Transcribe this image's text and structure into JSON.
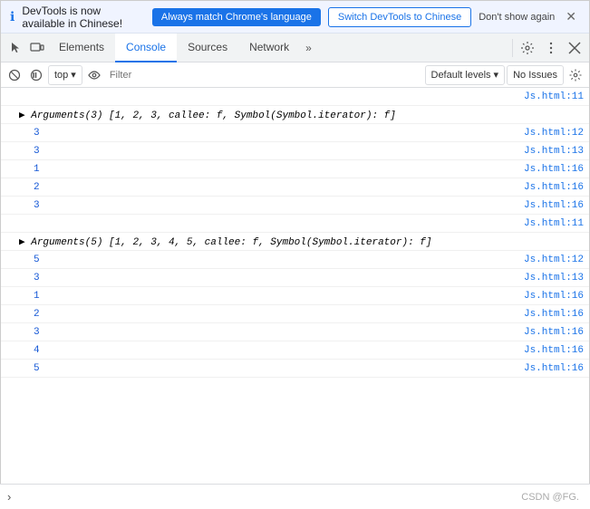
{
  "notification": {
    "text": "DevTools is now available in Chinese!",
    "btn_match_label": "Always match Chrome's language",
    "btn_switch_label": "Switch DevTools to Chinese",
    "dont_show_label": "Don't show again",
    "info_icon": "ℹ",
    "close_icon": "✕"
  },
  "tabs": {
    "icon_cursor": "⬚",
    "icon_device": "⬜",
    "items": [
      {
        "label": "Elements",
        "active": false
      },
      {
        "label": "Console",
        "active": true
      },
      {
        "label": "Sources",
        "active": false
      },
      {
        "label": "Network",
        "active": false
      }
    ],
    "more_icon": "»",
    "settings_icon": "⚙",
    "menu_icon": "⋮",
    "close_icon": "✕"
  },
  "console_toolbar": {
    "clear_icon": "🚫",
    "context_label": "top",
    "arrow_icon": "▾",
    "eye_icon": "👁",
    "filter_placeholder": "Filter",
    "level_label": "Default levels",
    "level_arrow": "▾",
    "no_issues_label": "No Issues",
    "settings_icon": "⚙"
  },
  "console_rows": [
    {
      "type": "source-ref",
      "content": "",
      "source": "Js.html:11",
      "indent": false
    },
    {
      "type": "arguments",
      "content": "▶ Arguments(3) [1, 2, 3, callee: f, Symbol(Symbol.iterator): f]",
      "source": "",
      "indent": false
    },
    {
      "type": "number",
      "content": "3",
      "source": "Js.html:12",
      "indent": true
    },
    {
      "type": "number",
      "content": "3",
      "source": "Js.html:13",
      "indent": true
    },
    {
      "type": "number",
      "content": "1",
      "source": "Js.html:16",
      "indent": true
    },
    {
      "type": "number",
      "content": "2",
      "source": "Js.html:16",
      "indent": true
    },
    {
      "type": "number",
      "content": "3",
      "source": "Js.html:16",
      "indent": true
    },
    {
      "type": "source-ref",
      "content": "",
      "source": "Js.html:11",
      "indent": false
    },
    {
      "type": "arguments",
      "content": "▶ Arguments(5) [1, 2, 3, 4, 5, callee: f, Symbol(Symbol.iterator): f]",
      "source": "",
      "indent": false
    },
    {
      "type": "number",
      "content": "5",
      "source": "Js.html:12",
      "indent": true
    },
    {
      "type": "number",
      "content": "3",
      "source": "Js.html:13",
      "indent": true
    },
    {
      "type": "number",
      "content": "1",
      "source": "Js.html:16",
      "indent": true
    },
    {
      "type": "number",
      "content": "2",
      "source": "Js.html:16",
      "indent": true
    },
    {
      "type": "number",
      "content": "3",
      "source": "Js.html:16",
      "indent": true
    },
    {
      "type": "number",
      "content": "4",
      "source": "Js.html:16",
      "indent": true
    },
    {
      "type": "number",
      "content": "5",
      "source": "Js.html:16",
      "indent": true
    }
  ],
  "console_input": {
    "prompt": "›",
    "watermark": "CSDN @FG."
  }
}
